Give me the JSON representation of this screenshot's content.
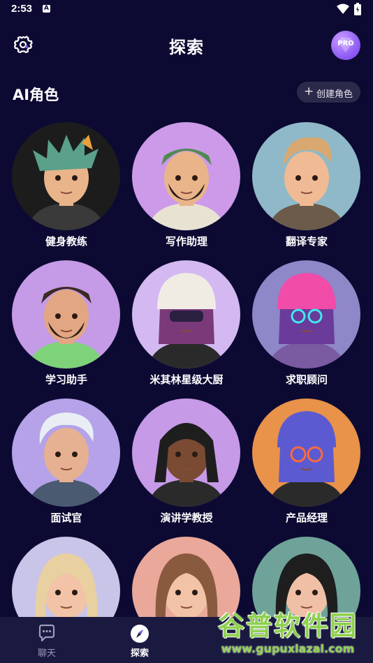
{
  "status_bar": {
    "time": "2:53",
    "notification_badge": "A"
  },
  "header": {
    "title": "探索",
    "pro_label": "PRO"
  },
  "section": {
    "title": "AI角色",
    "create_button_label": "创建角色",
    "create_button_icon": "plus-icon"
  },
  "characters": [
    {
      "name": "健身教练",
      "bg": "#1c1c1c",
      "skin": "#e9b48a",
      "hair": "#5aa08a",
      "shirt": "#3a3a3a",
      "style": "spiky"
    },
    {
      "name": "写作助理",
      "bg": "#cc9ae8",
      "skin": "#e9b48a",
      "hair": "#4f8a52",
      "shirt": "#e8e2d2",
      "style": "beard"
    },
    {
      "name": "翻译专家",
      "bg": "#8fb9c8",
      "skin": "#f0bb94",
      "hair": "#d9a870",
      "shirt": "#6c5a4a",
      "style": "quiff"
    },
    {
      "name": "学习助手",
      "bg": "#c59ae6",
      "skin": "#e3a683",
      "hair": "#3a2a22",
      "shirt": "#7ed27a",
      "style": "beard"
    },
    {
      "name": "米其林星级大厨",
      "bg": "#d4b8f2",
      "skin": "#d89a7a",
      "hair": "#7a3a7a",
      "shirt": "#2a2a2a",
      "style": "beanie-purple"
    },
    {
      "name": "求职顾问",
      "bg": "#8e87c8",
      "skin": "#efbfa6",
      "hair": "#6a3b9a",
      "shirt": "#7a5aa0",
      "style": "beanie-pink"
    },
    {
      "name": "面试官",
      "bg": "#b5a2e8",
      "skin": "#e6b192",
      "hair": "#e8eef4",
      "shirt": "#4a5a70",
      "style": "white-hair"
    },
    {
      "name": "演讲学教授",
      "bg": "#c79ae8",
      "skin": "#7a4a32",
      "hair": "#1e1e1e",
      "shirt": "#2a2a2a",
      "style": "braids"
    },
    {
      "name": "产品经理",
      "bg": "#e8924a",
      "skin": "#f1c6b0",
      "hair": "#5b5ad0",
      "shirt": "#2a2a2a",
      "style": "beanie-blue"
    },
    {
      "name": "",
      "bg": "#c9c5e8",
      "skin": "#f2c3a6",
      "hair": "#e9d0a0",
      "shirt": "#2a2a2a",
      "style": "long-blonde"
    },
    {
      "name": "",
      "bg": "#e9a89a",
      "skin": "#f2c3a6",
      "hair": "#8a5a3e",
      "shirt": "#2a2a2a",
      "style": "bob-brown"
    },
    {
      "name": "",
      "bg": "#6fa39a",
      "skin": "#f0c0a6",
      "hair": "#1e1e1e",
      "shirt": "#2a2a2a",
      "style": "bob-black"
    }
  ],
  "bottom_nav": [
    {
      "label": "聊天",
      "icon": "chat-icon",
      "active": false
    },
    {
      "label": "探索",
      "icon": "compass-icon",
      "active": true
    }
  ],
  "watermark": {
    "main": "谷普软件园",
    "url": "www.gupuxlazal.com"
  },
  "colors": {
    "background": "#0c0a32",
    "nav_background": "#1a1940",
    "accent": "#8a56f3",
    "button_bg": "#2b2a4a"
  }
}
